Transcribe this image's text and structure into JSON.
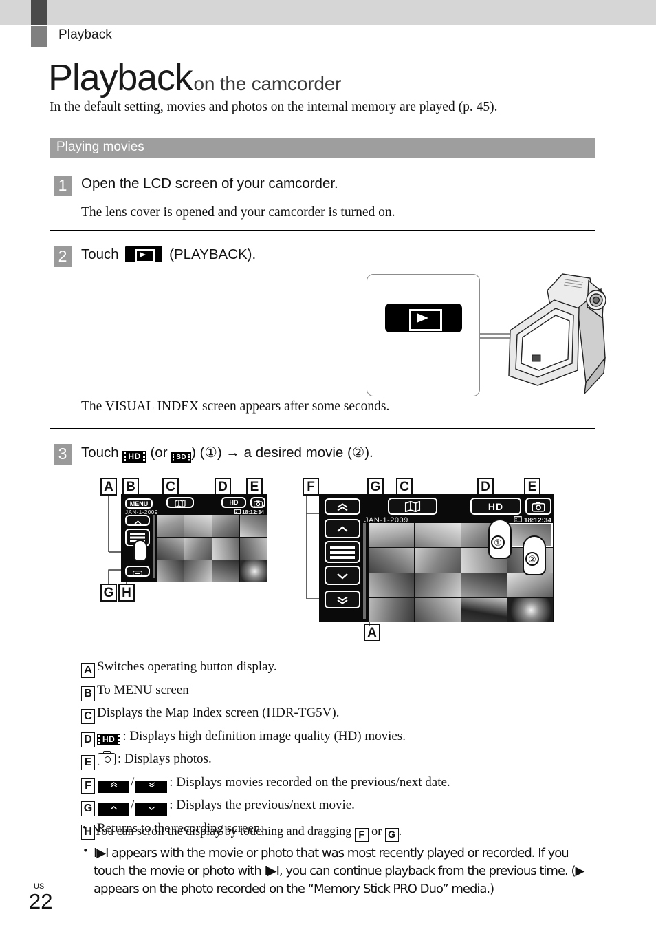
{
  "running_head": "Playback",
  "title": {
    "main": "Playback",
    "sub": "on the camcorder"
  },
  "lede": "In the default setting, movies and photos on the internal memory are played (p. 45).",
  "section": {
    "title": "Playing movies"
  },
  "steps": [
    {
      "num": "1",
      "title": "Open the LCD screen of your camcorder.",
      "body": "The lens cover is opened and your camcorder is turned on."
    },
    {
      "num": "2",
      "title_before": "Touch",
      "title_after": "(PLAYBACK).",
      "body": "The VISUAL INDEX screen appears after some seconds."
    },
    {
      "num": "3",
      "title_parts": [
        "Touch",
        "HD",
        "(or",
        "SD",
        ")",
        "(①)",
        "→",
        "a desired movie (②)."
      ]
    }
  ],
  "screens": {
    "left": {
      "menu_label": "MENU",
      "map_icon": "map-index-icon",
      "hd_label": "HD",
      "photo_icon": "photo-icon",
      "date": "JAN-1-2009",
      "counter": "18:12:34",
      "markers": [
        "A",
        "B",
        "C",
        "D",
        "E",
        "G",
        "H"
      ]
    },
    "right": {
      "map_icon": "map-index-icon",
      "hd_label": "HD",
      "photo_icon": "photo-icon",
      "date": "JAN-1-2009",
      "counter": "18:12:34",
      "markers": [
        "F",
        "G",
        "C",
        "D",
        "E",
        "A"
      ],
      "callout_1": "①",
      "callout_2": "②"
    }
  },
  "legend": [
    {
      "letter": "A",
      "text": "Switches operating button display."
    },
    {
      "letter": "B",
      "text": "To MENU screen"
    },
    {
      "letter": "C",
      "text": "Displays the Map Index screen (HDR-TG5V)."
    },
    {
      "letter": "D",
      "icon": "HD",
      "text": ": Displays high definition image quality (HD) movies."
    },
    {
      "letter": "E",
      "icon": "photo-icon",
      "text": ": Displays photos."
    },
    {
      "letter": "F",
      "keys": [
        "»",
        "»"
      ],
      "text": ": Displays movies recorded on the previous/next date."
    },
    {
      "letter": "G",
      "keys": [
        "^",
        "v"
      ],
      "text": ": Displays the previous/next movie."
    },
    {
      "letter": "H",
      "text": "Returns to the recording screen."
    }
  ],
  "bullets": [
    {
      "pre": "You can scroll the display by touching and dragging ",
      "k1": "F",
      "mid": " or ",
      "k2": "G",
      "post": "."
    },
    {
      "text": "I▶I appears with the movie or photo that was most recently played or recorded. If you touch the movie or photo with I▶I, you can continue playback from the previous time. (▶ appears on the photo recorded on the “Memory Stick PRO Duo” media.)"
    }
  ],
  "footer": {
    "region": "US",
    "page": "22"
  },
  "colors": {
    "topband": "#d6d6d6",
    "topband_tab": "#4a4a4a",
    "runhead_mark": "#808080",
    "section_bar": "#9e9e9e",
    "step_badge": "#9a9a9a",
    "screen_bg": "#0a0a0a",
    "arrow_gray": "#9a9a9a"
  }
}
